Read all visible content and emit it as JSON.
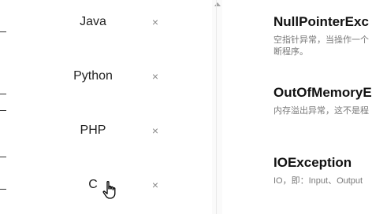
{
  "languages": [
    {
      "label": "Java",
      "remove_icon": "×"
    },
    {
      "label": "Python",
      "remove_icon": "×"
    },
    {
      "label": "PHP",
      "remove_icon": "×"
    },
    {
      "label": "C",
      "remove_icon": "×"
    }
  ],
  "exceptions": [
    {
      "title": "NullPointerExc",
      "desc_lines": [
        "空指针异常，当操作一个",
        "断程序。"
      ]
    },
    {
      "title": "OutOfMemoryE",
      "desc_lines": [
        "内存溢出异常，这不是程"
      ]
    },
    {
      "title": "IOException",
      "desc_lines": [
        "IO，即：Input、Output"
      ]
    }
  ],
  "icons": {
    "remove": "close-icon",
    "scroll_up": "scroll-up-arrow-icon",
    "cursor": "hand-pointer-icon"
  },
  "colors": {
    "text": "#222222",
    "muted": "#7a7a7a",
    "icon": "#8a8a8a",
    "divider": "#e8e8e8"
  }
}
